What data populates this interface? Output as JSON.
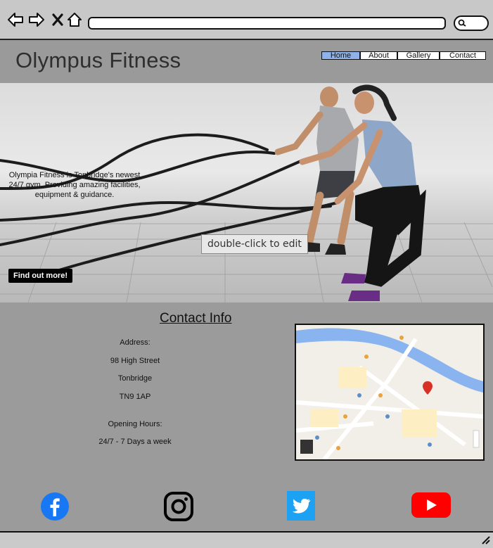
{
  "site": {
    "title": "Olympus Fitness"
  },
  "nav": {
    "items": [
      "Home",
      "About",
      "Gallery",
      "Contact"
    ],
    "active": "Home"
  },
  "hero": {
    "text": "Olympia Fitness is Tonbridge's newest 24/7 gym. Providing amazing facilities, equipment & guidance.",
    "button": "Find out more!",
    "edit_hint": "double-click to edit"
  },
  "contact": {
    "title": "Contact Info",
    "address_label": "Address:",
    "address_line1": "98 High Street",
    "address_line2": "Tonbridge",
    "postcode": "TN9 1AP",
    "hours_label": "Opening Hours:",
    "hours": "24/7 - 7 Days a week"
  },
  "social": [
    "facebook-icon",
    "instagram-icon",
    "twitter-icon",
    "youtube-icon"
  ],
  "colors": {
    "nav_active": "#8fb3e8",
    "facebook": "#1877f2",
    "twitter": "#1da1f2",
    "youtube": "#ff0000",
    "river": "#8ab4f0"
  }
}
